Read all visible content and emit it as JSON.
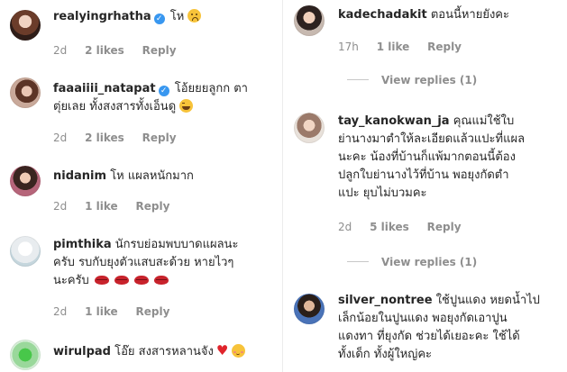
{
  "left_comments": [
    {
      "username": "realyingrhatha",
      "verified": true,
      "text": "โห",
      "emoji": "sad-face-emoji",
      "time": "2d",
      "likes": "2 likes",
      "reply": "Reply"
    },
    {
      "username": "faaaiiii_natapat",
      "verified": true,
      "text_line1": "โอ้ยยยลูกก ตา",
      "text_line2": "ตุ่ยเลย ทั้งสงสารทั้งเอ็นดู",
      "emoji": "rolling-laughing-emoji",
      "time": "2d",
      "likes": "2 likes",
      "reply": "Reply"
    },
    {
      "username": "nidanim",
      "verified": false,
      "text": "โห แผลหนักมาก",
      "time": "2d",
      "likes": "1 like",
      "reply": "Reply"
    },
    {
      "username": "pimthika",
      "verified": false,
      "text_line1": "นักรบย่อมพบบาดแผลนะ",
      "text_line2": "ครับ รบกับยุงตัวแสบสะด้วย หายไวๆ",
      "text_line3": "นะครับ",
      "emoji": "kiss-mark-emoji",
      "time": "2d",
      "likes": "1 like",
      "reply": "Reply"
    },
    {
      "username": "wirulpad",
      "verified": false,
      "text": "โอ๊ย สงสารหลานจัง",
      "emoji": "heart-emoji",
      "time": "",
      "likes": "",
      "reply": ""
    }
  ],
  "right_comments": [
    {
      "username": "kadechadakit",
      "text": "ตอนนี้หายยังคะ",
      "time": "17h",
      "likes": "1 like",
      "reply": "Reply",
      "view_replies": "View replies (1)"
    },
    {
      "username": "tay_kanokwan_ja",
      "text_line1": "คุณแม่ใช้ใบ",
      "text_line2": "ย่านางมาตำให้ละเอียดแล้วแปะที่แผล",
      "text_line3": "นะคะ น้องที่บ้านก็แพ้มากตอนนี้ต้อง",
      "text_line4": "ปลูกใบย่านางไว้ที่บ้าน พอยุงกัดตำ",
      "text_line5": "แปะ ยุบไม่บวมคะ",
      "time": "2d",
      "likes": "5 likes",
      "reply": "Reply",
      "view_replies": "View replies (1)"
    },
    {
      "username": "silver_nontree",
      "text_line1": "ใช้ปูนแดง หยดน้ำไป",
      "text_line2": "เล็กน้อยในปูนแดง พอยุงกัดเอาปูน",
      "text_line3": "แดงทา ที่ยุงกัด ช่วยได้เยอะคะ ใช้ได้",
      "text_line4": "ทั้งเด็ก ทั้งผู้ใหญ่คะ"
    }
  ],
  "colors": {
    "text": "#262626",
    "meta": "#8e8e8e",
    "verified": "#3897f0",
    "heart": "#e0242c"
  }
}
